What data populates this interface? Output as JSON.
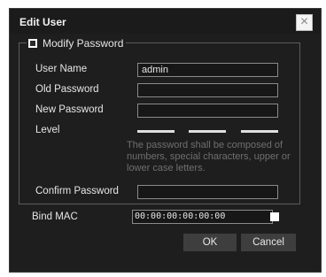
{
  "dialog": {
    "title": "Edit User",
    "close_glyph": "×",
    "close_icon": "close-icon"
  },
  "modify_password": {
    "label": "Modify Password",
    "checked": true
  },
  "fields": {
    "user_name": {
      "label": "User Name",
      "value": "admin"
    },
    "old_password": {
      "label": "Old Password",
      "value": ""
    },
    "new_password": {
      "label": "New Password",
      "value": ""
    },
    "level": {
      "label": "Level"
    },
    "hint": "The password shall be composed of numbers, special characters, upper or lower case letters.",
    "confirm_password": {
      "label": "Confirm Password",
      "value": ""
    }
  },
  "bind_mac": {
    "label": "Bind MAC",
    "value": "00:00:00:00:00:00",
    "checked": false
  },
  "buttons": {
    "ok": "OK",
    "cancel": "Cancel"
  },
  "colors": {
    "dialog_bg": "#1e1e1e",
    "button_bg": "#3e3e3e",
    "hint_text": "#6f6f6f"
  }
}
